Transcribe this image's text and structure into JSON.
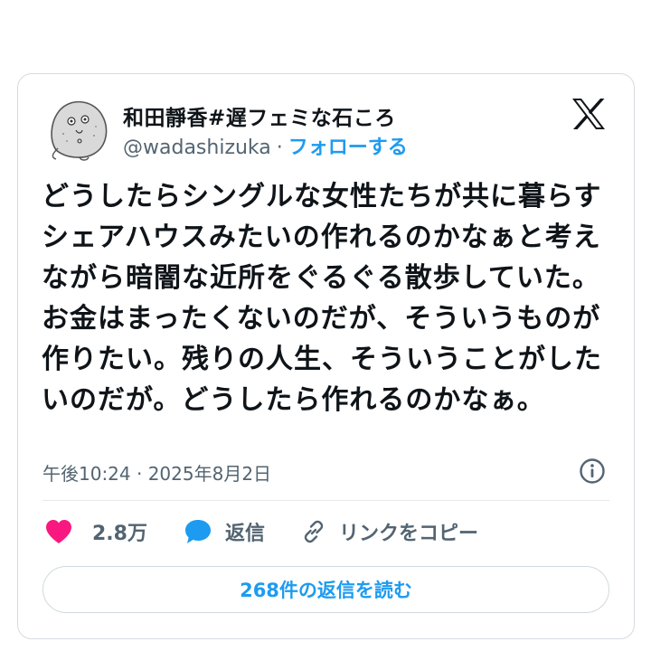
{
  "tweet": {
    "display_name": "和田靜香#遅フェミな石ころ",
    "handle": "@wadashizuka",
    "separator": "·",
    "follow_label": "フォローする",
    "text": "どうしたらシングルな女性たちが共に暮らすシェアハウスみたいの作れるのかなぁと考えながら暗闇な近所をぐるぐる散歩していた。お金はまったくないのだが、そういうものが作りたい。残りの人生、そういうことがしたいのだが。どうしたら作れるのかなぁ。",
    "timestamp": "午後10:24 · 2025年8月2日"
  },
  "actions": {
    "like_count": "2.8万",
    "reply_label": "返信",
    "copy_link_label": "リンクをコピー"
  },
  "replies_button_label": "268件の返信を読む",
  "colors": {
    "like_pink": "#f91880",
    "reply_blue": "#1d9bf0",
    "follow_blue": "#1d9bf0",
    "text_primary": "#0f1419",
    "text_secondary": "#536471"
  },
  "icons": {
    "avatar": "stone-character-avatar",
    "logo": "x-logo-icon",
    "info": "info-icon",
    "like": "heart-icon",
    "reply": "speech-bubble-icon",
    "link": "link-icon"
  }
}
